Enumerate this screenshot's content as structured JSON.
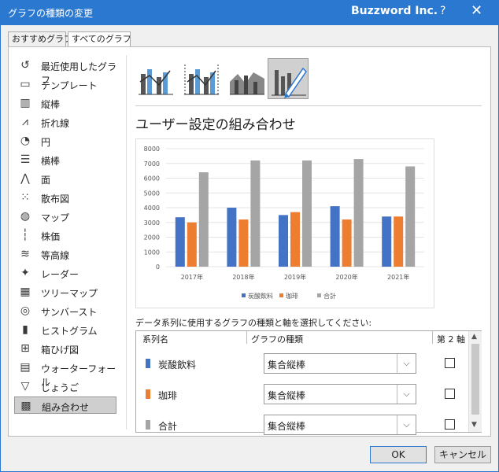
{
  "window": {
    "title": "グラフの種類の変更",
    "brand": "Buzzword Inc.",
    "help": "?",
    "close": "✕"
  },
  "tabs": [
    {
      "label": "おすすめグラフ"
    },
    {
      "label": "すべてのグラフ"
    }
  ],
  "sidebar": {
    "items": [
      {
        "label": "最近使用したグラフ",
        "icon": "recent-icon"
      },
      {
        "label": "テンプレート",
        "icon": "folder-icon"
      },
      {
        "label": "縦棒",
        "icon": "column-chart-icon"
      },
      {
        "label": "折れ線",
        "icon": "line-chart-icon"
      },
      {
        "label": "円",
        "icon": "pie-chart-icon"
      },
      {
        "label": "横棒",
        "icon": "bar-chart-icon"
      },
      {
        "label": "面",
        "icon": "area-chart-icon"
      },
      {
        "label": "散布図",
        "icon": "scatter-chart-icon"
      },
      {
        "label": "マップ",
        "icon": "map-chart-icon"
      },
      {
        "label": "株価",
        "icon": "stock-chart-icon"
      },
      {
        "label": "等高線",
        "icon": "surface-chart-icon"
      },
      {
        "label": "レーダー",
        "icon": "radar-chart-icon"
      },
      {
        "label": "ツリーマップ",
        "icon": "treemap-chart-icon"
      },
      {
        "label": "サンバースト",
        "icon": "sunburst-chart-icon"
      },
      {
        "label": "ヒストグラム",
        "icon": "histogram-chart-icon"
      },
      {
        "label": "箱ひげ図",
        "icon": "boxwhisker-chart-icon"
      },
      {
        "label": "ウォーターフォール",
        "icon": "waterfall-chart-icon"
      },
      {
        "label": "じょうご",
        "icon": "funnel-chart-icon"
      },
      {
        "label": "組み合わせ",
        "icon": "combo-chart-icon"
      }
    ],
    "selected": "組み合わせ"
  },
  "subtypes": [
    "clustered-column-line-icon",
    "clustered-column-line-secondary-icon",
    "stacked-area-column-icon",
    "custom-combo-icon"
  ],
  "heading": "ユーザー設定の組み合わせ",
  "chart_data": {
    "type": "bar",
    "categories": [
      "2017年",
      "2018年",
      "2019年",
      "2020年",
      "2021年"
    ],
    "series": [
      {
        "name": "炭酸飲料",
        "values": [
          3350,
          4000,
          3500,
          4100,
          3400
        ],
        "color": "#4472c4"
      },
      {
        "name": "珈琲",
        "values": [
          3000,
          3200,
          3700,
          3200,
          3400
        ],
        "color": "#ed7d31"
      },
      {
        "name": "合計",
        "values": [
          6400,
          7200,
          7200,
          7300,
          6800
        ],
        "color": "#a5a5a5"
      }
    ],
    "ylim": [
      0,
      8000
    ],
    "yticks": [
      0,
      1000,
      2000,
      3000,
      4000,
      5000,
      6000,
      7000,
      8000
    ],
    "legend": "bottom",
    "grid": true
  },
  "instruction": "データ系列に使用するグラフの種類と軸を選択してください:",
  "table": {
    "headers": {
      "series": "系列名",
      "type": "グラフの種類",
      "secondary": "第 2 軸"
    },
    "rows": [
      {
        "name": "炭酸飲料",
        "type": "集合縦棒",
        "color": "#4472c4",
        "secondary": false
      },
      {
        "name": "珈琲",
        "type": "集合縦棒",
        "color": "#ed7d31",
        "secondary": false
      },
      {
        "name": "合計",
        "type": "集合縦棒",
        "color": "#a5a5a5",
        "secondary": false
      }
    ]
  },
  "buttons": {
    "ok": "OK",
    "cancel": "キャンセル"
  }
}
